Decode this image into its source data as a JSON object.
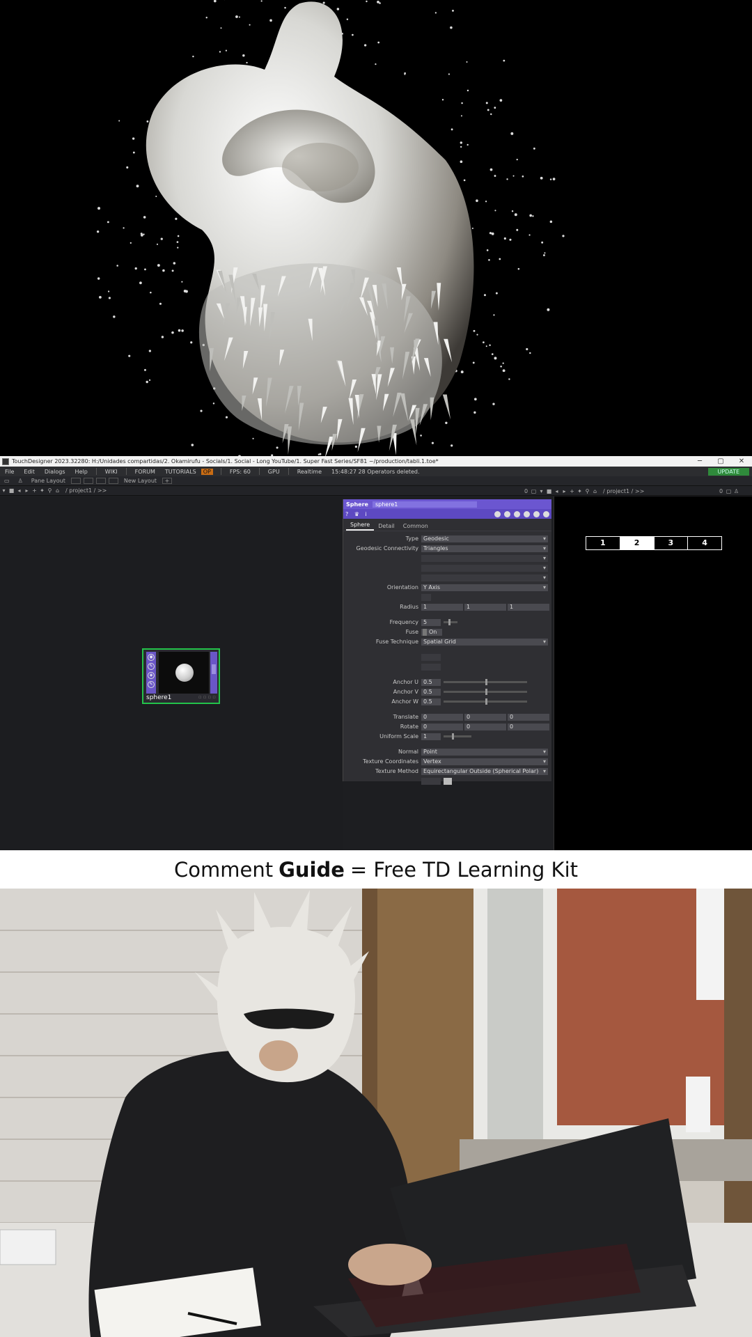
{
  "window": {
    "title": "TouchDesigner 2023.32280: H:/Unidades compartidas/2. Okamirufu - Socials/1. Social - Long YouTube/1. Super Fast Series/SF81 ~/production/tabli.1.toe*",
    "minimize": "─",
    "maximize": "▢",
    "close": "✕"
  },
  "menubar": {
    "items": [
      "File",
      "Edit",
      "Dialogs",
      "Help"
    ],
    "wiki": "WIKI",
    "forum": "FORUM",
    "tutorials": "TUTORIALS",
    "op_badge": "OP",
    "fps": "FPS: 60",
    "gpu": "GPU",
    "realtime": "Realtime",
    "status": "15:48:27 28 Operators deleted.",
    "update": "UPDATE"
  },
  "toolbar": {
    "pane_layout": "Pane Layout",
    "new_layout": "New Layout",
    "add": "+",
    "path_left": "/ project1 / >>",
    "path_right": "/ project1 / >>",
    "count_left": "0",
    "count_right": "0"
  },
  "node": {
    "name": "sphere1"
  },
  "params": {
    "op_type": "Sphere",
    "op_name": "sphere1",
    "help": "?",
    "info": "i",
    "tabs": [
      "Sphere",
      "Detail",
      "Common"
    ],
    "active_tab": "Sphere",
    "type": {
      "label": "Type",
      "value": "Geodesic"
    },
    "geodesic_connectivity": {
      "label": "Geodesic Connectivity",
      "value": "Triangles"
    },
    "orientation": {
      "label": "Orientation",
      "value": "Y Axis"
    },
    "radius": {
      "label": "Radius",
      "values": [
        "1",
        "1",
        "1"
      ]
    },
    "frequency": {
      "label": "Frequency",
      "value": "5",
      "level": 0.35
    },
    "fuse": {
      "label": "Fuse",
      "value": "On"
    },
    "fuse_technique": {
      "label": "Fuse Technique",
      "value": "Spatial Grid"
    },
    "anchor_u": {
      "label": "Anchor U",
      "value": "0.5",
      "level": 0.5
    },
    "anchor_v": {
      "label": "Anchor V",
      "value": "0.5",
      "level": 0.5
    },
    "anchor_w": {
      "label": "Anchor W",
      "value": "0.5",
      "level": 0.5
    },
    "translate": {
      "label": "Translate",
      "values": [
        "0",
        "0",
        "0"
      ]
    },
    "rotate": {
      "label": "Rotate",
      "values": [
        "0",
        "0",
        "0"
      ]
    },
    "uniform_scale": {
      "label": "Uniform Scale",
      "value": "1",
      "level": 0.3
    },
    "normal": {
      "label": "Normal",
      "value": "Point"
    },
    "texture_coordinates": {
      "label": "Texture Coordinates",
      "value": "Vertex"
    },
    "texture_method": {
      "label": "Texture Method",
      "value": "Equirectangular Outside (Spherical Polar)"
    }
  },
  "viewer": {
    "tabs": [
      "1",
      "2",
      "3",
      "4"
    ],
    "selected": "2"
  },
  "caption": {
    "before": "Comment",
    "bold": "Guide",
    "after": "= Free TD Learning Kit"
  },
  "colors": {
    "node_border": "#23c34a",
    "op_header": "#6b56d0",
    "update": "#2f8a3b"
  }
}
